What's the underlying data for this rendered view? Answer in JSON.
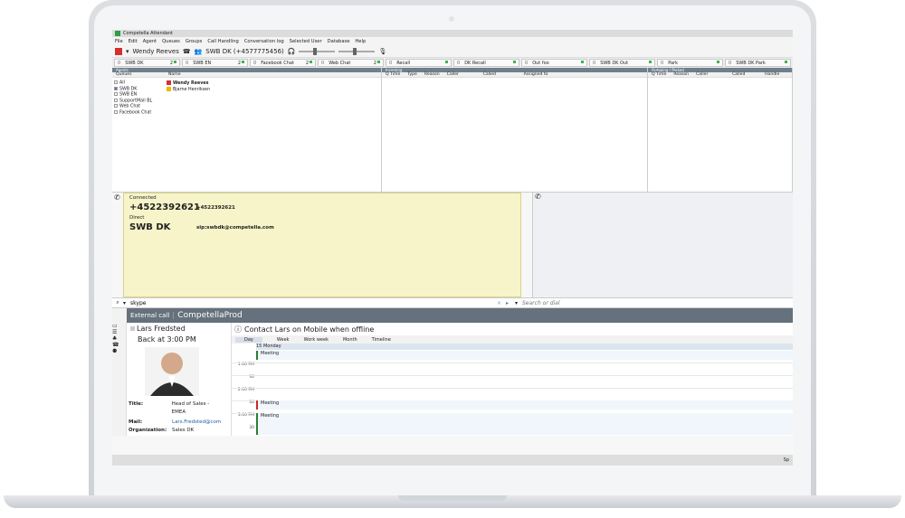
{
  "window": {
    "title": "Competella Attendant"
  },
  "menu": [
    "File",
    "Edit",
    "Agent",
    "Queues",
    "Groups",
    "Call Handling",
    "Conversation log",
    "Selected User",
    "Database",
    "Help"
  ],
  "toolbar": {
    "user": "Wendy Reeves",
    "queue": "SWB DK (+4577775456)"
  },
  "queue_tabs": [
    {
      "n": "0",
      "label": "SWB DK",
      "count": "2"
    },
    {
      "n": "0",
      "label": "SWB EN",
      "count": "2"
    },
    {
      "n": "0",
      "label": "Facebook Chat",
      "count": "2"
    },
    {
      "n": "0",
      "label": "Web Chat",
      "count": "2"
    },
    {
      "n": "0",
      "label": "Recall",
      "count": ""
    },
    {
      "n": "0",
      "label": "DK Recall",
      "count": ""
    },
    {
      "n": "0",
      "label": "Out foo",
      "count": ""
    },
    {
      "n": "0",
      "label": "SWB DK Out",
      "count": ""
    },
    {
      "n": "0",
      "label": "Park",
      "count": ""
    },
    {
      "n": "0",
      "label": "SWB DK Park",
      "count": ""
    }
  ],
  "agents": {
    "title": "Agents",
    "col_queues": "Queues",
    "col_name": "Name",
    "queues": [
      {
        "label": "All",
        "checked": false
      },
      {
        "label": "SWB DK",
        "checked": true
      },
      {
        "label": "SWB EN",
        "checked": false
      },
      {
        "label": "SupportMail BL",
        "checked": false
      },
      {
        "label": "Web Chat",
        "checked": false
      },
      {
        "label": "Facebook Chat",
        "checked": false
      }
    ],
    "names": [
      {
        "label": "Wendy Reeves",
        "color": "#d32f2f"
      },
      {
        "label": "Bjarne Henriksen",
        "color": "#f4b400"
      }
    ]
  },
  "incoming": {
    "title": "Incoming",
    "cols": [
      "Q Time",
      "Type",
      "Reason",
      "Caller",
      "Called",
      "Assigned to"
    ]
  },
  "outgoing": {
    "title": "Outgoing / Parked",
    "cols": [
      "Q Time",
      "Reason",
      "Caller",
      "Called",
      "Handle"
    ]
  },
  "call": {
    "status": "Connected",
    "number": "+4522392621",
    "number_small": "+4522392621",
    "route": "Direct",
    "queue": "SWB DK",
    "sip": "sip:swbdk@competella.com"
  },
  "search": {
    "value": "skype",
    "placeholder": "Search or dial"
  },
  "contact_header": {
    "type": "External call",
    "name": "CompetellaProd"
  },
  "person": {
    "name": "Lars Fredsted",
    "status": "Back at 3:00 PM",
    "title_label": "Title:",
    "title": "Head of Sales - EMEA",
    "mail_label": "Mail:",
    "mail": "Lars.Fredsted@com",
    "org_label": "Organization:",
    "org": "Sales DK"
  },
  "calendar": {
    "note": "Contact Lars on Mobile when offline",
    "tabs": [
      "Day",
      "Week",
      "Work week",
      "Month",
      "Timeline"
    ],
    "date": "15 Monday",
    "times": [
      "1:00 PM",
      "30",
      "2:00 PM",
      "30",
      "3:00 PM",
      "30"
    ],
    "events": [
      "Meeting",
      "Meeting",
      "Meeting"
    ]
  },
  "statusbar": {
    "right": "Sp"
  }
}
